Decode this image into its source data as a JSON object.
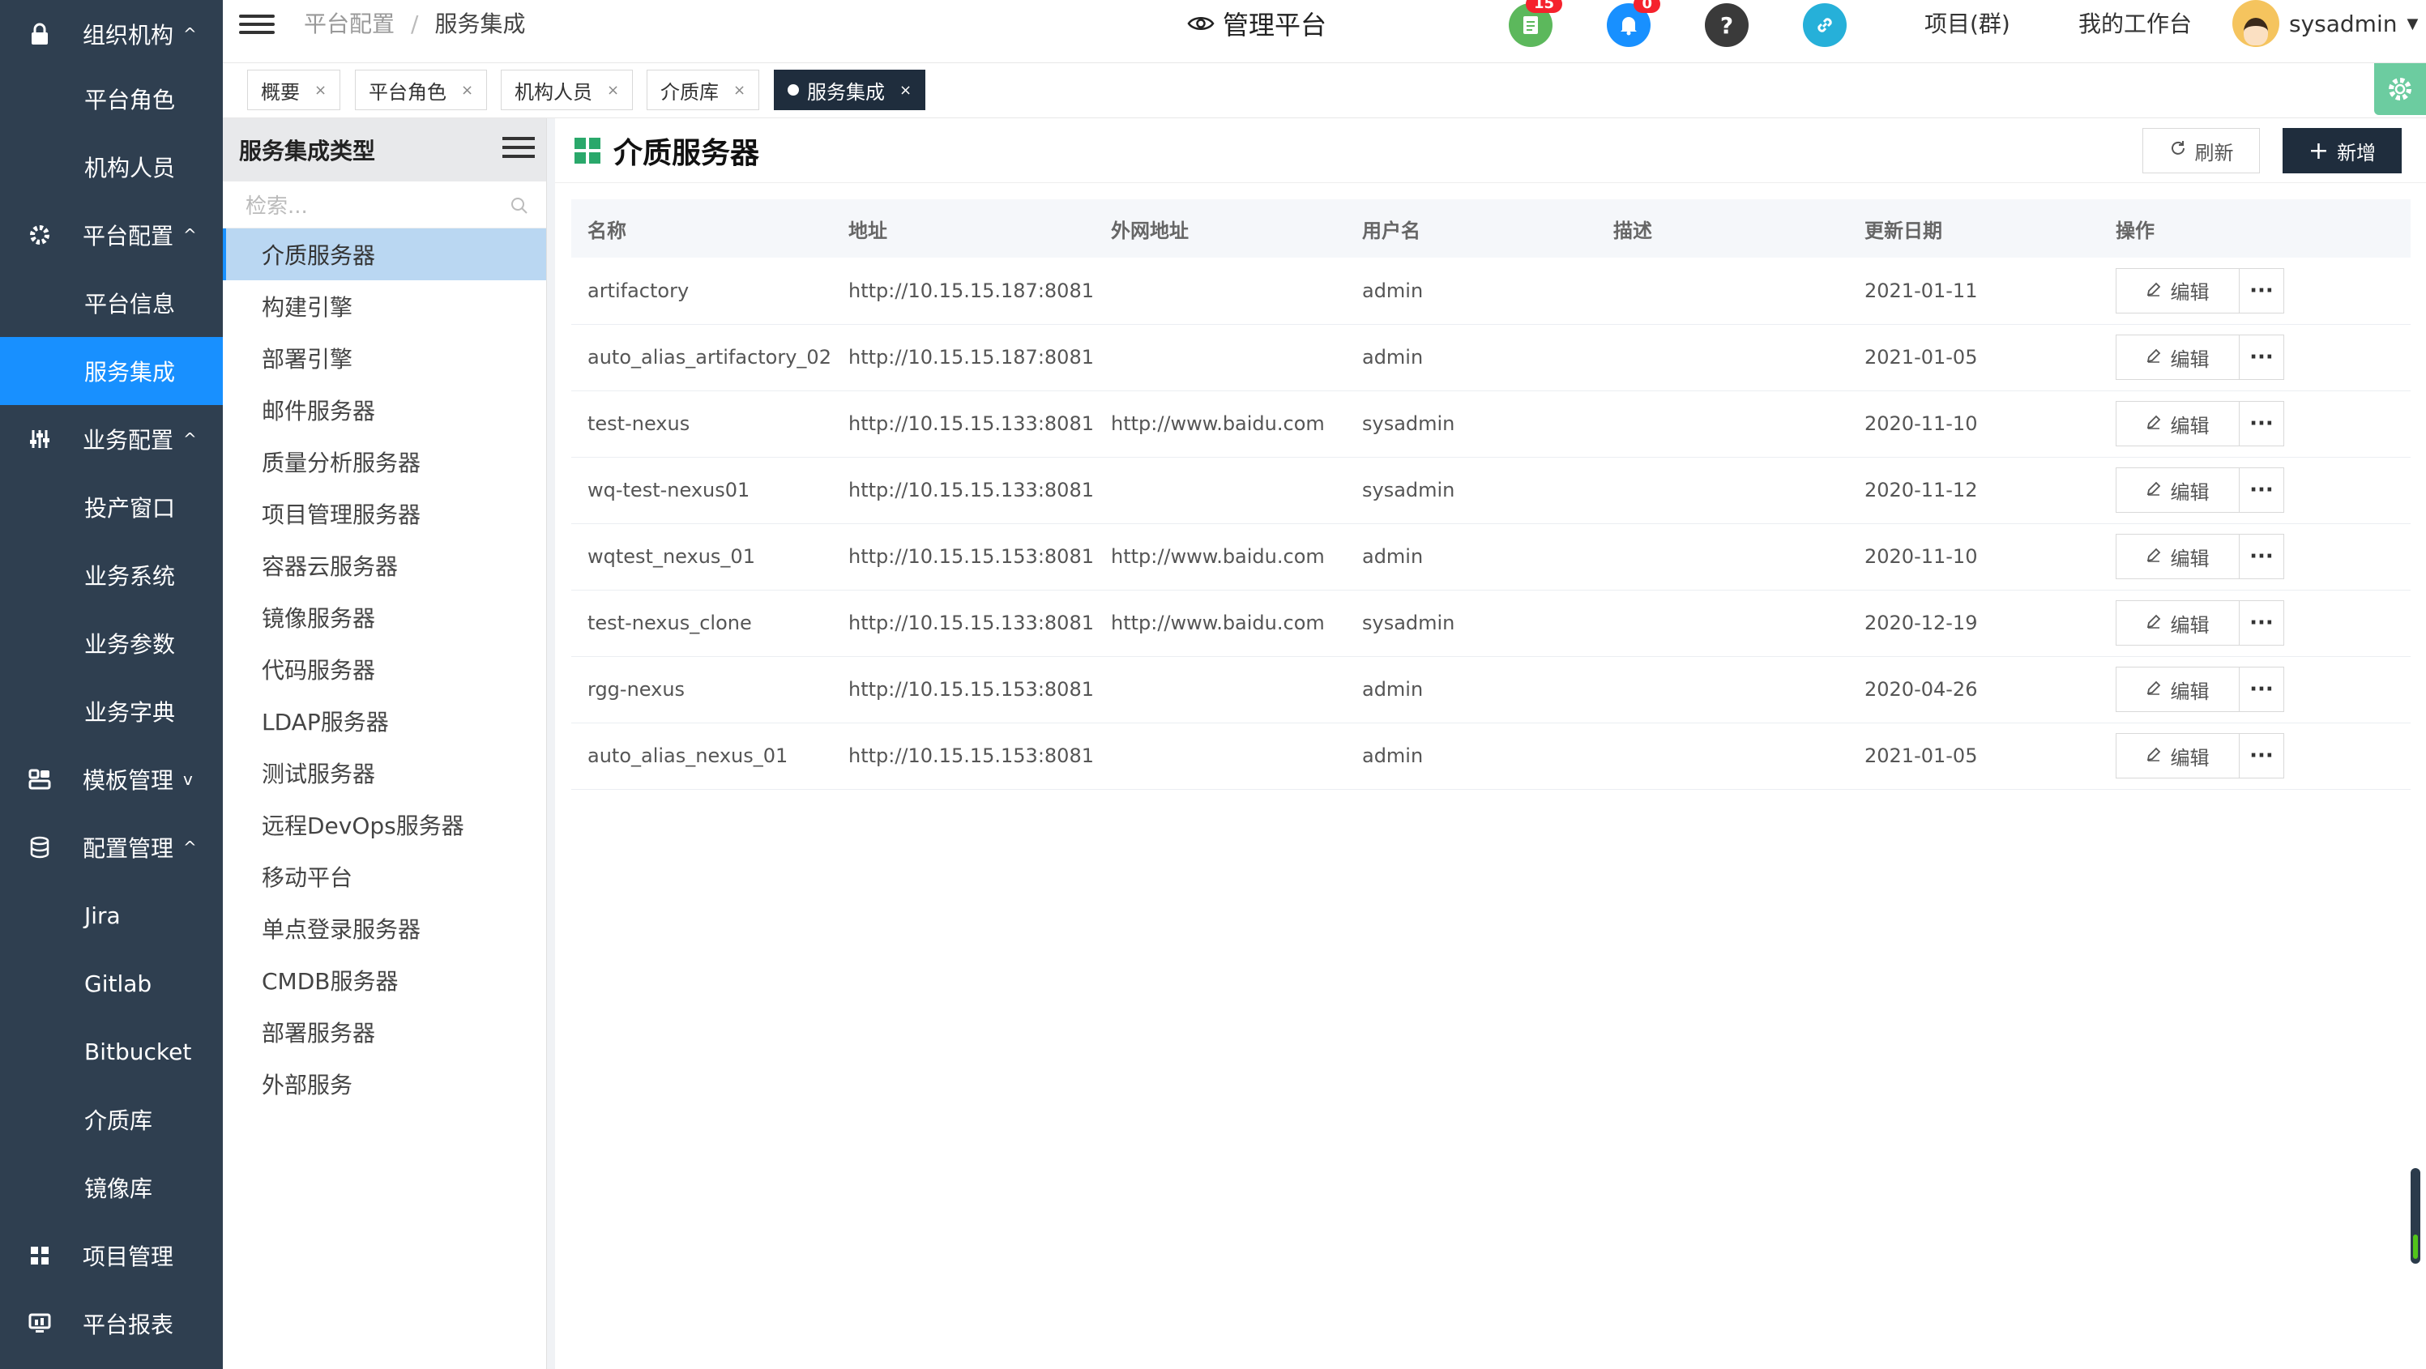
{
  "sidebar": {
    "items": [
      {
        "label": "组织机构",
        "icon": "lock-icon",
        "chevron": "^"
      },
      {
        "label": "平台角色"
      },
      {
        "label": "机构人员"
      },
      {
        "label": "平台配置",
        "icon": "gear-icon",
        "chevron": "^"
      },
      {
        "label": "平台信息"
      },
      {
        "label": "服务集成"
      },
      {
        "label": "业务配置",
        "icon": "sliders-icon",
        "chevron": "^"
      },
      {
        "label": "投产窗口"
      },
      {
        "label": "业务系统"
      },
      {
        "label": "业务参数"
      },
      {
        "label": "业务字典"
      },
      {
        "label": "模板管理",
        "icon": "template-icon",
        "chevron": "v"
      },
      {
        "label": "配置管理",
        "icon": "database-icon",
        "chevron": "^"
      },
      {
        "label": "Jira"
      },
      {
        "label": "Gitlab"
      },
      {
        "label": "Bitbucket"
      },
      {
        "label": "介质库"
      },
      {
        "label": "镜像库"
      },
      {
        "label": "项目管理",
        "icon": "grid-icon"
      },
      {
        "label": "平台报表",
        "icon": "report-icon"
      }
    ]
  },
  "header": {
    "breadcrumb": [
      "平台配置",
      "服务集成"
    ],
    "title": "管理平台",
    "icons": [
      {
        "name": "doc-icon",
        "color": "#5cb85c",
        "badge": "15"
      },
      {
        "name": "bell-icon",
        "color": "#1890ff",
        "badge": "0"
      },
      {
        "name": "help-icon",
        "color": "#3a3a3a",
        "badge": ""
      },
      {
        "name": "link-icon",
        "color": "#26b0d9",
        "badge": ""
      }
    ],
    "links": [
      "项目(群)",
      "我的工作台"
    ],
    "username": "sysadmin"
  },
  "tabs": [
    "概要",
    "平台角色",
    "机构人员",
    "介质库",
    "服务集成"
  ],
  "type_panel": {
    "title": "服务集成类型",
    "search_placeholder": "检索...",
    "items": [
      "介质服务器",
      "构建引擎",
      "部署引擎",
      "邮件服务器",
      "质量分析服务器",
      "项目管理服务器",
      "容器云服务器",
      "镜像服务器",
      "代码服务器",
      "LDAP服务器",
      "测试服务器",
      "远程DevOps服务器",
      "移动平台",
      "单点登录服务器",
      "CMDB服务器",
      "部署服务器",
      "外部服务"
    ]
  },
  "main": {
    "title": "介质服务器",
    "refresh_label": "刷新",
    "add_label": "新增",
    "columns": [
      "名称",
      "地址",
      "外网地址",
      "用户名",
      "描述",
      "更新日期",
      "操作"
    ],
    "edit_label": "编辑",
    "more_label": "···",
    "rows": [
      {
        "name": "artifactory",
        "address": "http://10.15.15.187:8081",
        "external": "",
        "user": "admin",
        "desc": "",
        "date": "2021-01-11"
      },
      {
        "name": "auto_alias_artifactory_02",
        "address": "http://10.15.15.187:8081",
        "external": "",
        "user": "admin",
        "desc": "",
        "date": "2021-01-05"
      },
      {
        "name": "test-nexus",
        "address": "http://10.15.15.133:8081",
        "external": "http://www.baidu.com",
        "user": "sysadmin",
        "desc": "",
        "date": "2020-11-10"
      },
      {
        "name": "wq-test-nexus01",
        "address": "http://10.15.15.133:8081",
        "external": "",
        "user": "sysadmin",
        "desc": "",
        "date": "2020-11-12"
      },
      {
        "name": "wqtest_nexus_01",
        "address": "http://10.15.15.153:8081",
        "external": "http://www.baidu.com",
        "user": "admin",
        "desc": "",
        "date": "2020-11-10"
      },
      {
        "name": "test-nexus_clone",
        "address": "http://10.15.15.133:8081",
        "external": "http://www.baidu.com",
        "user": "sysadmin",
        "desc": "",
        "date": "2020-12-19"
      },
      {
        "name": "rgg-nexus",
        "address": "http://10.15.15.153:8081",
        "external": "",
        "user": "admin",
        "desc": "",
        "date": "2020-04-26"
      },
      {
        "name": "auto_alias_nexus_01",
        "address": "http://10.15.15.153:8081",
        "external": "",
        "user": "admin",
        "desc": "",
        "date": "2021-01-05"
      }
    ]
  }
}
